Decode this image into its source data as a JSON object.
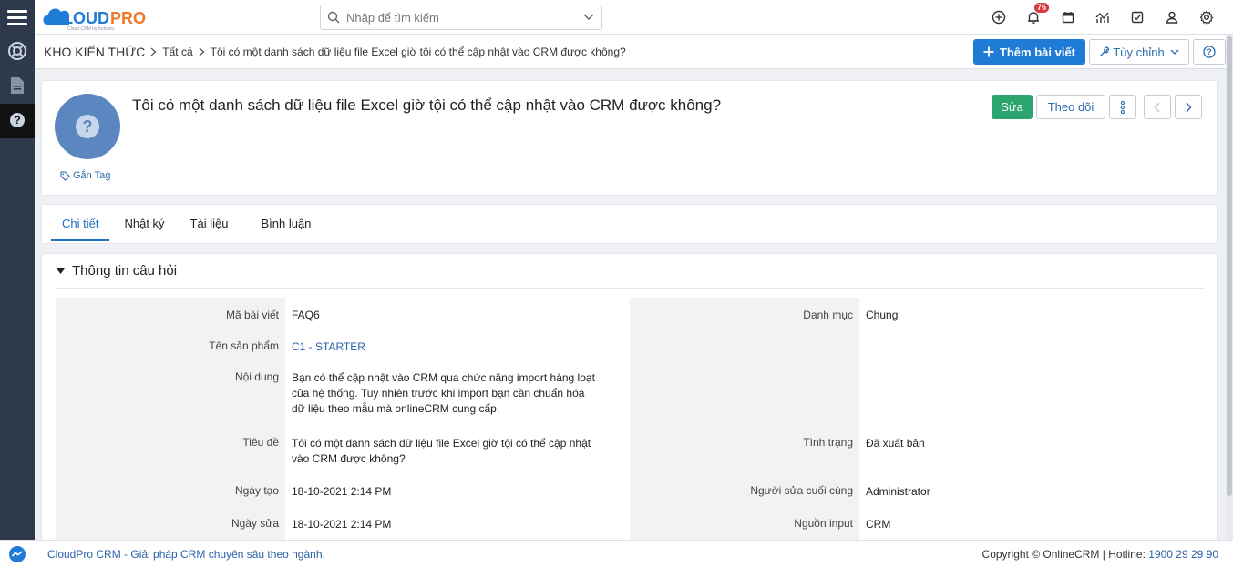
{
  "app": {
    "logo_text": "CLOUDPRO",
    "logo_tagline": "Cloud CRM by Industry",
    "brand_blue": "#1e7bd6",
    "brand_orange": "#f0782a"
  },
  "search": {
    "placeholder": "Nhập để tìm kiếm"
  },
  "topbar": {
    "icons": [
      "plus-circle-icon",
      "bell-icon",
      "calendar-icon",
      "chart-icon",
      "checkbox-icon",
      "user-icon",
      "gear-icon"
    ],
    "notification_count": "76"
  },
  "sidebar": {
    "items": [
      "lifebuoy-icon",
      "document-icon",
      "question-icon"
    ]
  },
  "breadcrumb": {
    "root": "KHO KIẾN THỨC",
    "level1": "Tất cả",
    "current": "Tôi có một danh sách dữ liệu file Excel giờ tội có thể cập nhật vào CRM được không?"
  },
  "actions": {
    "add_article": "Thêm bài viết",
    "customize": "Tùy chỉnh",
    "help": "?"
  },
  "record": {
    "title": "Tôi có một danh sách dữ liệu file Excel giờ tội có thể cập nhật vào CRM được không?",
    "tag_label": "Gắn Tag",
    "edit_label": "Sửa",
    "follow_label": "Theo dõi"
  },
  "tabs": [
    {
      "label": "Chi tiết"
    },
    {
      "label": "Nhật ký"
    },
    {
      "label": "Tài liệu"
    },
    {
      "label": "Bình luận"
    }
  ],
  "section": {
    "title": "Thông tin câu hỏi",
    "fields": {
      "article_code": {
        "label": "Mã bài viết",
        "value": "FAQ6"
      },
      "category": {
        "label": "Danh mục",
        "value": "Chung"
      },
      "product_name": {
        "label": "Tên sản phẩm",
        "value": "C1 - STARTER"
      },
      "content": {
        "label": "Nội dung",
        "value": "Bạn có thể cập nhật vào CRM qua chức năng import hàng loạt của hệ thống. Tuy nhiên trước khi import bạn cần chuẩn hóa dữ liệu theo mẫu mà onlineCRM cung cấp."
      },
      "subject": {
        "label": "Tiêu đề",
        "value": "Tôi có một danh sách dữ liệu file Excel giờ tội có thể cập nhật vào CRM được không?"
      },
      "status": {
        "label": "Tình trạng",
        "value": "Đã xuất bản"
      },
      "created": {
        "label": "Ngày tạo",
        "value": "18-10-2021 2:14 PM"
      },
      "last_modified_by": {
        "label": "Người sửa cuối cùng",
        "value": "Administrator"
      },
      "modified": {
        "label": "Ngày sửa",
        "value": "18-10-2021 2:14 PM"
      },
      "input_source": {
        "label": "Nguồn input",
        "value": "CRM"
      }
    }
  },
  "footer": {
    "left": "CloudPro CRM - Giải pháp CRM chuyên sâu theo ngành.",
    "copyright": "Copyright © OnlineCRM | Hotline: ",
    "hotline": "1900 29 29 90"
  }
}
